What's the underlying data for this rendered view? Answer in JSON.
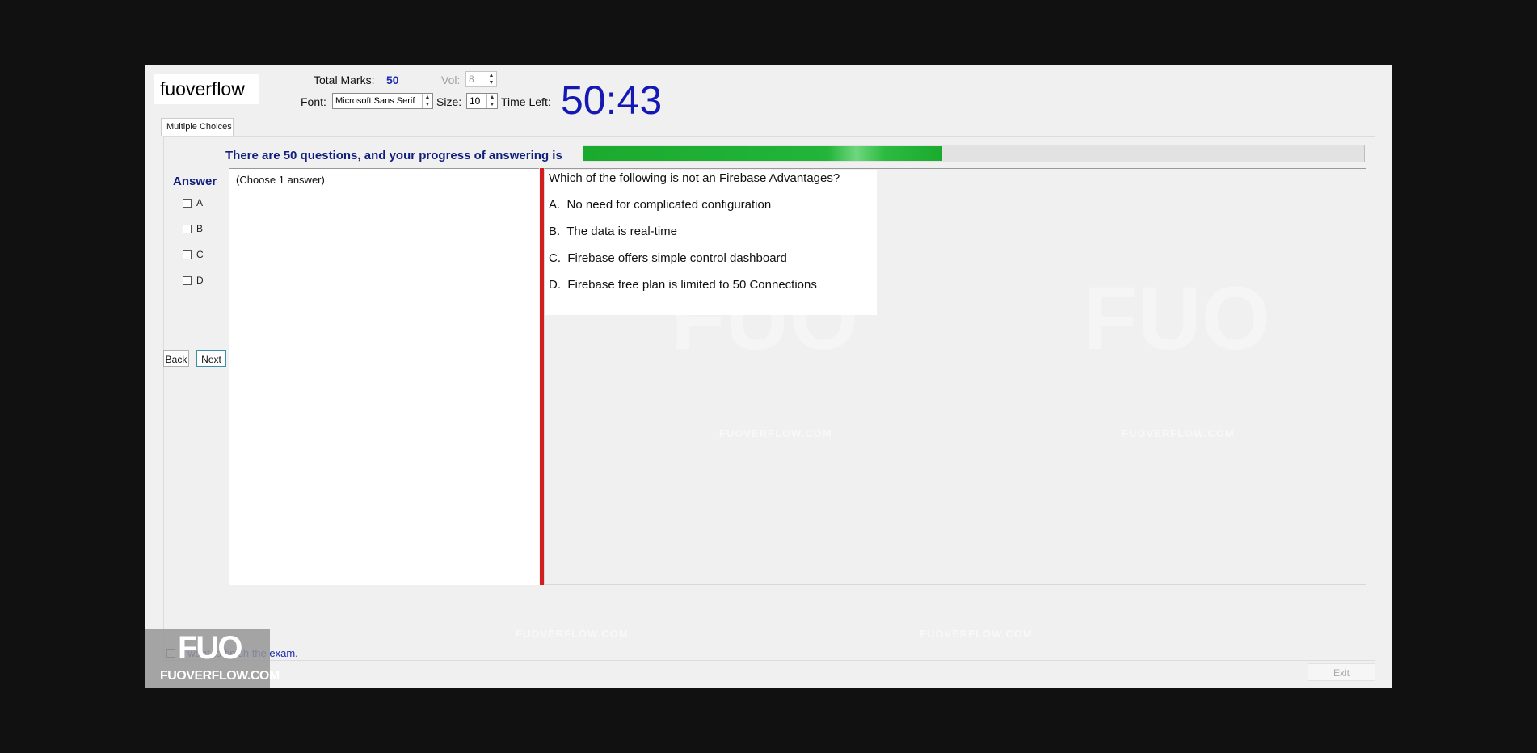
{
  "app": {
    "logo_text": "fuoverflow"
  },
  "header": {
    "total_marks_label": "Total Marks:",
    "total_marks_value": "50",
    "vol_label": "Vol:",
    "vol_value": "8",
    "font_label": "Font:",
    "font_value": "Microsoft Sans Serif",
    "size_label": "Size:",
    "size_value": "10",
    "time_left_label": "Time Left:",
    "time_left_value": "50:43"
  },
  "tabs": [
    {
      "label": "Multiple Choices",
      "active": true
    }
  ],
  "progress": {
    "label": "There are 50 questions, and your progress of answering is",
    "fraction": 0.46
  },
  "answer": {
    "title": "Answer",
    "options": [
      "A",
      "B",
      "C",
      "D"
    ]
  },
  "nav": {
    "back_label": "Back",
    "next_label": "Next"
  },
  "left_pane": {
    "instruction": "(Choose 1 answer)"
  },
  "question": {
    "text": "Which of the following is not an Firebase Advantages?",
    "options": [
      {
        "letter": "A.",
        "text": "No need for complicated configuration"
      },
      {
        "letter": "B.",
        "text": "The data is real-time"
      },
      {
        "letter": "C.",
        "text": "Firebase offers simple control dashboard"
      },
      {
        "letter": "D.",
        "text": "Firebase free plan is limited to 50 Connections"
      }
    ]
  },
  "footer": {
    "finish_label": "I want to finish the exam.",
    "exit_label": "Exit"
  },
  "watermark": {
    "badge_big": "FUO",
    "badge_small": "FUOVERFLOW.COM",
    "repeat_text": "FUOVERFLOW.COM"
  },
  "colors": {
    "timer": "#1418b4",
    "progress_fill": "#1aaa2e",
    "divider": "#d11e1e",
    "label_blue": "#101e7c"
  }
}
